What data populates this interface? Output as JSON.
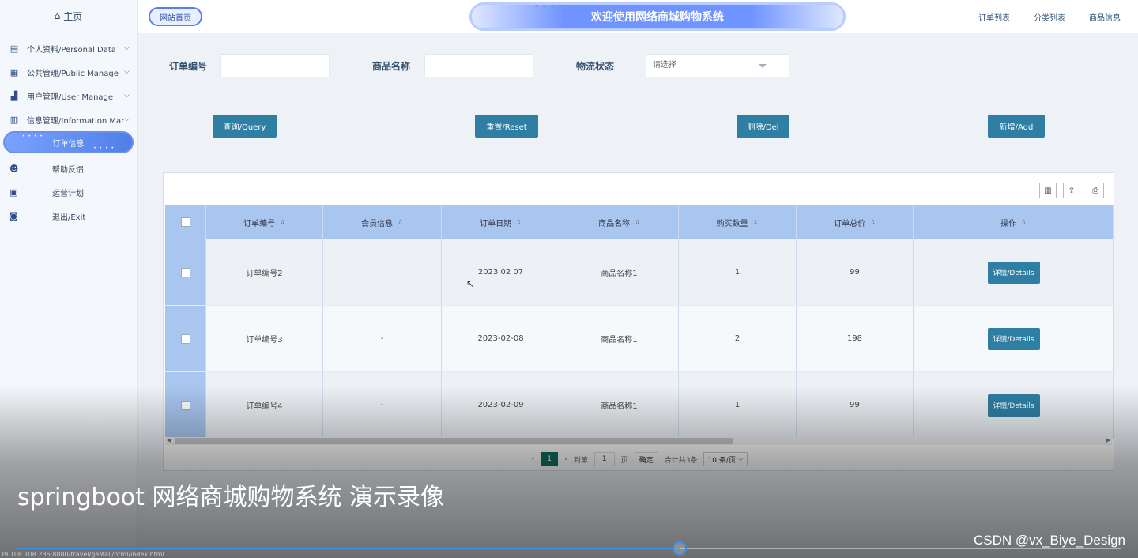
{
  "sidebar": {
    "home_label": "主页",
    "menu": [
      {
        "label": "个人资料/Personal Data",
        "icon": "person-doc-icon"
      },
      {
        "label": "公共管理/Public Manage",
        "icon": "doc-icon"
      },
      {
        "label": "用户管理/User Manage",
        "icon": "users-icon"
      },
      {
        "label": "信息管理/Information Manage",
        "icon": "chart-icon"
      }
    ],
    "active_sub": "订单信息",
    "plain": [
      {
        "label": "帮助反馈",
        "icon": "help-icon"
      },
      {
        "label": "运营计划",
        "icon": "calendar-icon"
      },
      {
        "label": "退出/Exit",
        "icon": "exit-icon"
      }
    ]
  },
  "header": {
    "site_home": "网站首页",
    "title": "欢迎使用网络商城购物系统",
    "links": [
      "订单列表",
      "分类列表",
      "商品信息"
    ]
  },
  "search": {
    "order_no_label": "订单编号",
    "goods_name_label": "商品名称",
    "logistics_label": "物流状态",
    "select_placeholder": "请选择"
  },
  "buttons": {
    "query": "查询/Query",
    "reset": "重置/Reset",
    "delete": "删除/Del",
    "add": "新增/Add"
  },
  "table": {
    "headers": [
      "订单编号",
      "会员信息",
      "订单日期",
      "商品名称",
      "购买数量",
      "订单总价",
      "操作"
    ],
    "rows": [
      {
        "order_no": "订单编号2",
        "member": "",
        "date": "2023 02 07",
        "goods": "商品名称1",
        "qty": "1",
        "total": "99",
        "action": "详情/Details"
      },
      {
        "order_no": "订单编号3",
        "member": "-",
        "date": "2023-02-08",
        "goods": "商品名称1",
        "qty": "2",
        "total": "198",
        "action": "详情/Details"
      },
      {
        "order_no": "订单编号4",
        "member": "-",
        "date": "2023-02-09",
        "goods": "商品名称1",
        "qty": "1",
        "total": "99",
        "action": "详情/Details"
      }
    ]
  },
  "pager": {
    "current_page": "1",
    "goto_label": "到第",
    "goto_value": "1",
    "page_unit": "页",
    "confirm": "确定",
    "total": "合计共3条",
    "page_size": "10 条/页"
  },
  "video": {
    "caption": "springboot 网络商城购物系统 演示录像",
    "watermark": "CSDN @vx_Biye_Design",
    "progress": 0.6,
    "url": "39.108.108.236:8080/travel/geMall/html/index.html"
  },
  "colors": {
    "primary_button": "#2f7fa4",
    "header_row": "#a9c6f0",
    "accent": "#6f93ff"
  }
}
